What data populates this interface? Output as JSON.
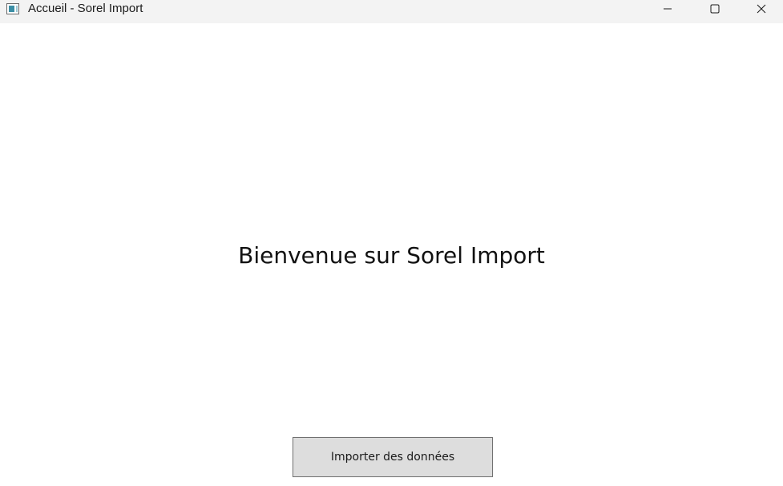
{
  "window": {
    "title": "Accueil - Sorel Import",
    "app_icon": "window-app-icon",
    "controls": {
      "minimize_icon": "minimize-icon",
      "maximize_icon": "maximize-icon",
      "close_icon": "close-icon"
    }
  },
  "main": {
    "welcome_text": "Bienvenue sur Sorel Import",
    "import_button_label": "Importer des données"
  },
  "colors": {
    "titlebar_bg": "#f3f3f3",
    "content_bg": "#ffffff",
    "button_bg": "#dddddd",
    "button_border": "#707070",
    "text": "#111111"
  }
}
